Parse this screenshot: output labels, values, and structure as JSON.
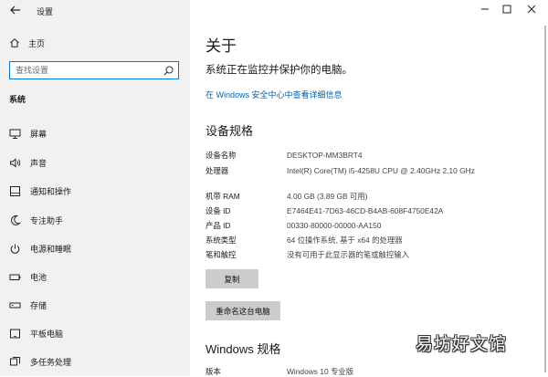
{
  "window": {
    "title": "设置",
    "controls": [
      "minimize-icon",
      "maximize-icon",
      "close-icon"
    ]
  },
  "sidebar": {
    "home_label": "主页",
    "search_placeholder": "查找设置",
    "section_label": "系统",
    "items": [
      {
        "label": "屏幕",
        "icon": "monitor-icon"
      },
      {
        "label": "声音",
        "icon": "speaker-icon"
      },
      {
        "label": "通知和操作",
        "icon": "notification-icon"
      },
      {
        "label": "专注助手",
        "icon": "moon-icon"
      },
      {
        "label": "电源和睡眠",
        "icon": "power-icon"
      },
      {
        "label": "电池",
        "icon": "battery-icon"
      },
      {
        "label": "存储",
        "icon": "storage-icon"
      },
      {
        "label": "平板电脑",
        "icon": "tablet-icon"
      },
      {
        "label": "多任务处理",
        "icon": "multitask-icon"
      }
    ]
  },
  "main": {
    "title": "关于",
    "status_text": "系统正在监控并保护你的电脑。",
    "security_link": "在 Windows 安全中心中查看详细信息",
    "device_specs_title": "设备规格",
    "device_specs": [
      {
        "key": "设备名称",
        "value": "DESKTOP-MM3BRT4"
      },
      {
        "key": "处理器",
        "value": "Intel(R) Core(TM) i5-4258U CPU @ 2.40GHz   2.10 GHz"
      },
      {
        "key": "机带 RAM",
        "value": "4.00 GB (3.89 GB 可用)"
      },
      {
        "key": "设备 ID",
        "value": "E7464E41-7D63-46CD-B4AB-608F4750E42A"
      },
      {
        "key": "产品 ID",
        "value": "00330-80000-00000-AA150"
      },
      {
        "key": "系统类型",
        "value": "64 位操作系统, 基于 x64 的处理器"
      },
      {
        "key": "笔和触控",
        "value": "没有可用于此显示器的笔或触控输入"
      }
    ],
    "copy_button": "复制",
    "rename_button": "重命名这台电脑",
    "windows_specs_title": "Windows 规格",
    "windows_specs": [
      {
        "key": "版本",
        "value": "Windows 10 专业版"
      }
    ]
  },
  "watermark": "易坊好文馆",
  "colors": {
    "accent": "#0078d7",
    "link": "#0063b1",
    "sidebar_bg": "#f1f1f1",
    "button_bg": "#cccccc"
  }
}
